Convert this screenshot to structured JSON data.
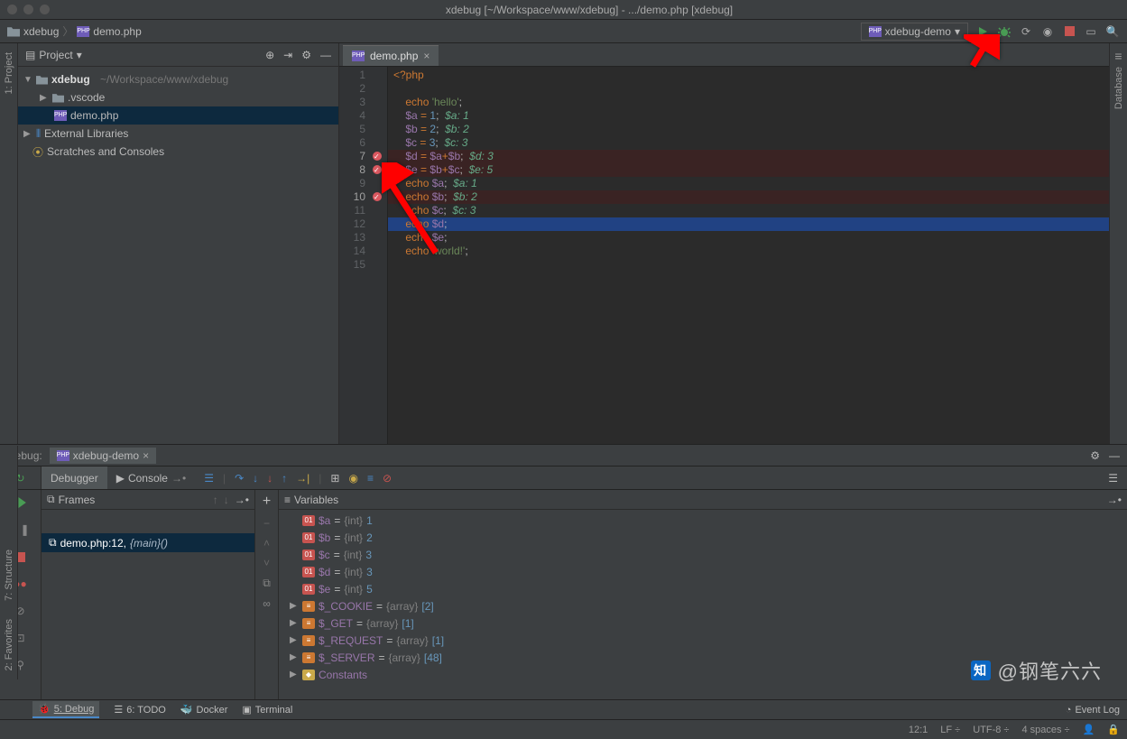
{
  "window": {
    "title": "xdebug [~/Workspace/www/xdebug] - .../demo.php [xdebug]"
  },
  "breadcrumb": {
    "root": "xdebug",
    "file": "demo.php"
  },
  "runConfig": {
    "name": "xdebug-demo"
  },
  "projectPanel": {
    "title": "Project",
    "root": "xdebug",
    "rootPath": "~/Workspace/www/xdebug",
    "vscode": ".vscode",
    "demo": "demo.php",
    "extLib": "External Libraries",
    "scratches": "Scratches and Consoles"
  },
  "leftRail": {
    "project": "1: Project",
    "structure": "7: Structure",
    "favorites": "2: Favorites"
  },
  "rightRail": {
    "database": "Database"
  },
  "editor": {
    "tab": "demo.php",
    "lines": [
      {
        "n": 1,
        "html": "<span class='kw'>&lt;?php</span>"
      },
      {
        "n": 2,
        "html": ""
      },
      {
        "n": 3,
        "html": "    <span class='kw'>echo</span> <span class='str'>'hello'</span>;"
      },
      {
        "n": 4,
        "html": "    <span class='var'>$a</span> <span class='op'>=</span> <span class='num'>1</span>;  <span class='hint'>$a: 1</span>"
      },
      {
        "n": 5,
        "html": "    <span class='var'>$b</span> <span class='op'>=</span> <span class='num'>2</span>;  <span class='hint'>$b: 2</span>"
      },
      {
        "n": 6,
        "html": "    <span class='var'>$c</span> <span class='op'>=</span> <span class='num'>3</span>;  <span class='hint'>$c: 3</span>"
      },
      {
        "n": 7,
        "html": "    <span class='var'>$d</span> <span class='op'>=</span> <span class='var'>$a</span><span class='op'>+</span><span class='var'>$b</span>;  <span class='hint'>$d: 3</span>",
        "bp": true
      },
      {
        "n": 8,
        "html": "    <span class='var'>$e</span> <span class='op'>=</span> <span class='var'>$b</span><span class='op'>+</span><span class='var'>$c</span>;  <span class='hint'>$e: 5</span>",
        "bp": true
      },
      {
        "n": 9,
        "html": "    <span class='kw'>echo</span> <span class='var'>$a</span>;  <span class='hint'>$a: 1</span>"
      },
      {
        "n": 10,
        "html": "    <span class='kw'>echo</span> <span class='var'>$b</span>;  <span class='hint'>$b: 2</span>",
        "bp": true
      },
      {
        "n": 11,
        "html": "    <span class='kw'>echo</span> <span class='var'>$c</span>;  <span class='hint'>$c: 3</span>"
      },
      {
        "n": 12,
        "html": "    <span class='kw'>echo</span> <span class='var'>$d</span>;",
        "current": true
      },
      {
        "n": 13,
        "html": "    <span class='kw'>echo</span> <span class='var'>$e</span>;"
      },
      {
        "n": 14,
        "html": "    <span class='kw'>echo</span> <span class='str'>'world!'</span>;"
      },
      {
        "n": 15,
        "html": ""
      }
    ]
  },
  "debug": {
    "label": "Debug:",
    "session": "xdebug-demo",
    "tabs": {
      "debugger": "Debugger",
      "console": "Console"
    },
    "frames": {
      "title": "Frames",
      "row": "demo.php:12, ",
      "row_fn": "{main}()"
    },
    "variables": {
      "title": "Variables",
      "rows": [
        {
          "name": "$a",
          "type": "{int}",
          "value": "1",
          "kind": "scalar"
        },
        {
          "name": "$b",
          "type": "{int}",
          "value": "2",
          "kind": "scalar"
        },
        {
          "name": "$c",
          "type": "{int}",
          "value": "3",
          "kind": "scalar"
        },
        {
          "name": "$d",
          "type": "{int}",
          "value": "3",
          "kind": "scalar"
        },
        {
          "name": "$e",
          "type": "{int}",
          "value": "5",
          "kind": "scalar"
        },
        {
          "name": "$_COOKIE",
          "type": "{array}",
          "value": "[2]",
          "kind": "array",
          "expandable": true
        },
        {
          "name": "$_GET",
          "type": "{array}",
          "value": "[1]",
          "kind": "array",
          "expandable": true
        },
        {
          "name": "$_REQUEST",
          "type": "{array}",
          "value": "[1]",
          "kind": "array",
          "expandable": true
        },
        {
          "name": "$_SERVER",
          "type": "{array}",
          "value": "[48]",
          "kind": "array",
          "expandable": true
        },
        {
          "name": "Constants",
          "type": "",
          "value": "",
          "kind": "const",
          "expandable": true
        }
      ]
    }
  },
  "bottomBar": {
    "debug": "5: Debug",
    "todo": "6: TODO",
    "docker": "Docker",
    "terminal": "Terminal",
    "eventLog": "Event Log"
  },
  "status": {
    "pos": "12:1",
    "lf": "LF",
    "enc": "UTF-8",
    "indent": "4 spaces"
  },
  "watermark": "@钢笔六六"
}
